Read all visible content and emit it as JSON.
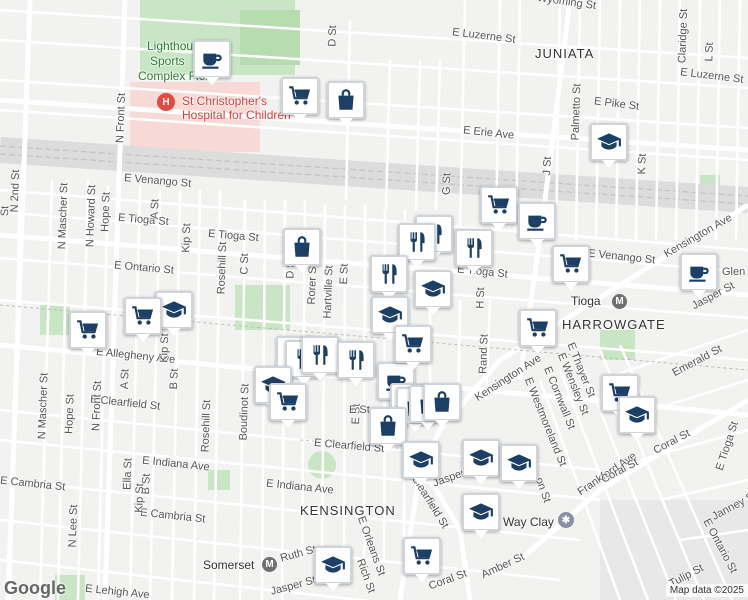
{
  "map": {
    "neighborhoods": {
      "juniata": "JUNIATA",
      "harrowgate": "HARROWGATE",
      "kensington": "KENSINGTON"
    },
    "places": {
      "hospital": {
        "line1": "St Christopher's",
        "line2": "Hospital for Children"
      },
      "sports_complex": {
        "line1": "Lighthouse",
        "line2": "Sports",
        "line3": "Complex Field"
      },
      "tioga_station": "Tioga",
      "somerset_station": "Somerset",
      "way_clay": "Way Clay"
    },
    "streets": {
      "e_luzerne": "E Luzerne St",
      "e_luzerne_2": "E Luzerne St",
      "e_erie": "E Erie Ave",
      "e_pike": "E Pike St",
      "e_venango_w": "E Venango St",
      "e_venango_e": "E Venango St",
      "e_tioga_w": "E Tioga St",
      "e_tioga_e": "E Tioga St",
      "e_ontario": "E Ontario St",
      "e_allegheny": "E Allegheny Ave",
      "e_clearfield_w": "E Clearfield St",
      "e_clearfield_mid": "E Clearfield St",
      "clearfield_diag": "Clearfield St",
      "e_indiana_w": "E Indiana Ave",
      "e_indiana_mid": "E Indiana Ave",
      "e_cambria_w": "E Cambria St",
      "e_cambria_mid": "E Cambria St",
      "e_lehigh": "E Lehigh Ave",
      "frankford": "Frankford Ave",
      "kensington_ave": "Kensington Ave",
      "kensington_ave_ne": "Kensington Ave",
      "n_2nd": "N 2nd St",
      "n_front": "N Front St",
      "n_front_s": "N Front St",
      "n_mascher": "N Mascher St",
      "n_mascher_s": "N Mascher St",
      "n_howard": "N Howard St",
      "n_lee": "N Lee St",
      "hope": "Hope St",
      "hope_s": "Hope St",
      "b_st": "B St",
      "b_st_s": "B St",
      "a_st": "A St",
      "a_st_s": "A St",
      "kip": "Kip St",
      "kip_mid": "Kip St",
      "kip_s": "Kip St",
      "rosehill": "Rosehill St",
      "rosehill_s": "Rosehill St",
      "c_st": "C St",
      "d_st": "D St",
      "d_st_n": "D St",
      "rorer": "Rorer St",
      "hartville": "Hartville St",
      "e_st": "E St",
      "e_st_s": "E St",
      "g_st": "G St",
      "h_st": "H St",
      "j_st": "J St",
      "k_st": "K St",
      "l_st": "L St",
      "rand": "Rand St",
      "boudinot": "Boudinot St",
      "ella": "Ella St",
      "claridge": "Claridge St",
      "palmetto": "Palmetto St",
      "e_thayer": "E Thayer St",
      "e_wensley": "E Wensley St",
      "e_cornwall": "E Cornwall St",
      "e_westmoreland": "E Westmoreland St",
      "emerald": "Emerald St",
      "coral": "Coral St",
      "coral_s": "Coral St",
      "coral_se": "Coral St",
      "e_tioga_se": "E Tioga St",
      "janney": "Janney St",
      "jasper": "Jasper St",
      "jasper_ne": "Jasper St",
      "jasper_s": "Jasper St",
      "amber": "Amber St",
      "tulip": "Tulip St",
      "e_ontario_se": "E Ontario St",
      "ruth": "Ruth St",
      "e_orleans": "E Orleans St",
      "rich": "Rich St",
      "wyoming": "Wyoming St",
      "glen": "Glen",
      "on_st": "on St",
      "e_st_lower": "E St",
      "st_frag": "St"
    },
    "markers": [
      {
        "icon": "cafe"
      },
      {
        "icon": "grocery"
      },
      {
        "icon": "shopping"
      },
      {
        "icon": "school"
      },
      {
        "icon": "grocery"
      },
      {
        "icon": "cafe"
      },
      {
        "icon": "restaurant"
      },
      {
        "icon": "restaurant"
      },
      {
        "icon": "restaurant"
      },
      {
        "icon": "shopping"
      },
      {
        "icon": "grocery"
      },
      {
        "icon": "restaurant"
      },
      {
        "icon": "school"
      },
      {
        "icon": "cafe"
      },
      {
        "icon": "school"
      },
      {
        "icon": "grocery"
      },
      {
        "icon": "grocery"
      },
      {
        "icon": "school"
      },
      {
        "icon": "grocery"
      },
      {
        "icon": "restaurant"
      },
      {
        "icon": "restaurant"
      },
      {
        "icon": "restaurant"
      },
      {
        "icon": "restaurant"
      },
      {
        "icon": "school"
      },
      {
        "icon": "grocery"
      },
      {
        "icon": "cafe"
      },
      {
        "icon": "shopping"
      },
      {
        "icon": "shopping"
      },
      {
        "icon": "shopping"
      },
      {
        "icon": "shopping"
      },
      {
        "icon": "shopping"
      },
      {
        "icon": "grocery"
      },
      {
        "icon": "grocery"
      },
      {
        "icon": "school"
      },
      {
        "icon": "school"
      },
      {
        "icon": "school"
      },
      {
        "icon": "school"
      },
      {
        "icon": "school"
      },
      {
        "icon": "grocery"
      },
      {
        "icon": "school"
      }
    ],
    "colors": {
      "marker_icon": "#1c3f66",
      "park": "#c8e6c4",
      "hospital_area": "#f7d9d5",
      "hospital_icon": "#e24b41",
      "transit_icon": "#707070"
    },
    "attribution": "Map data ©2025",
    "logo": "Google"
  }
}
